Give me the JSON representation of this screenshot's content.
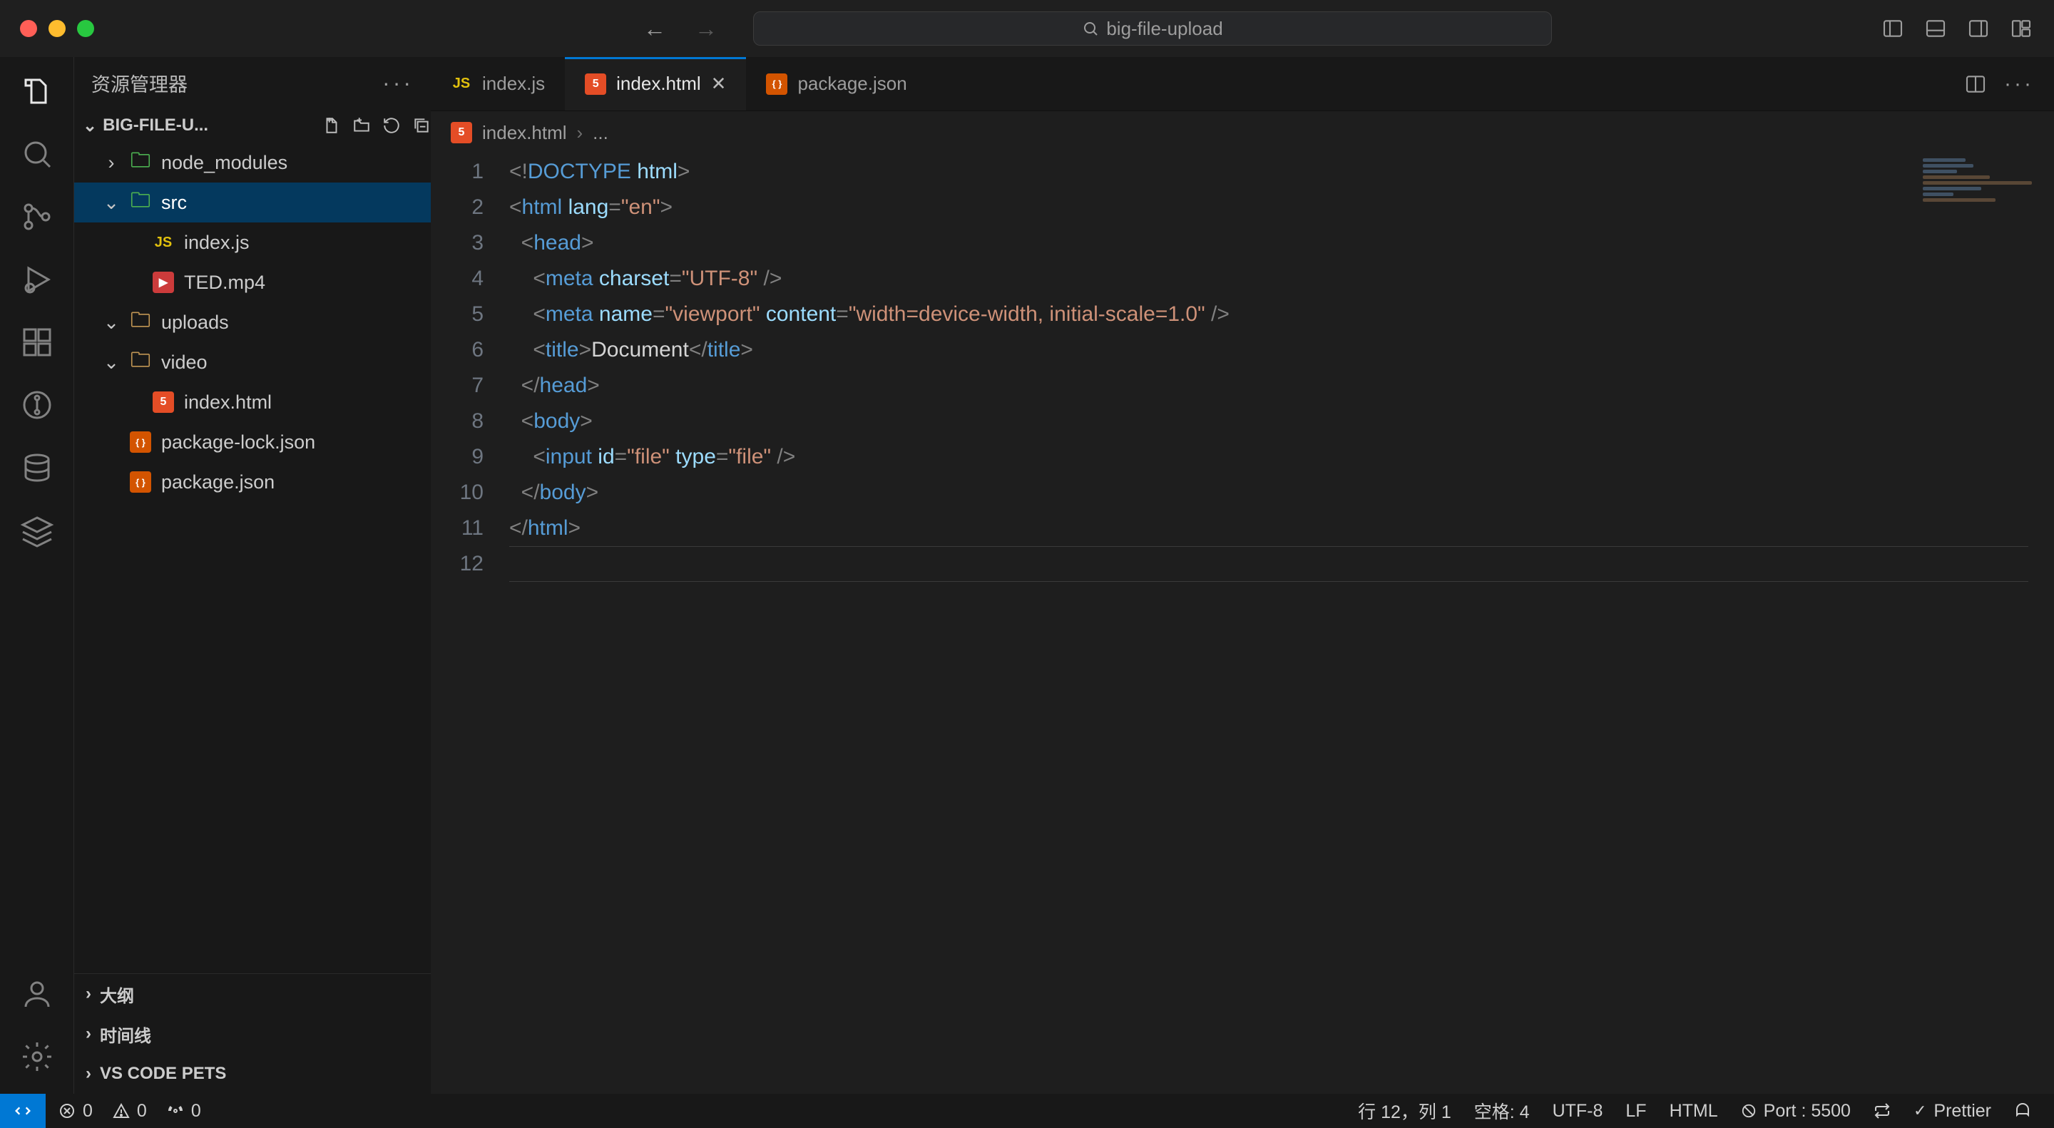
{
  "window": {
    "search_text": "big-file-upload"
  },
  "sidebar": {
    "title": "资源管理器",
    "project": "BIG-FILE-U...",
    "tree": [
      {
        "kind": "folder",
        "label": "node_modules",
        "depth": 1,
        "open": false,
        "chev": "›",
        "icon": "green"
      },
      {
        "kind": "folder",
        "label": "src",
        "depth": 1,
        "open": true,
        "chev": "⌄",
        "icon": "green",
        "selected": true
      },
      {
        "kind": "file",
        "label": "index.js",
        "depth": 2,
        "icon": "js"
      },
      {
        "kind": "file",
        "label": "TED.mp4",
        "depth": 2,
        "icon": "video"
      },
      {
        "kind": "folder",
        "label": "uploads",
        "depth": 1,
        "open": true,
        "chev": "⌄",
        "icon": "folder"
      },
      {
        "kind": "folder",
        "label": "video",
        "depth": 1,
        "open": true,
        "chev": "⌄",
        "icon": "folder"
      },
      {
        "kind": "file",
        "label": "index.html",
        "depth": 2,
        "icon": "html"
      },
      {
        "kind": "file",
        "label": "package-lock.json",
        "depth": 1,
        "icon": "json"
      },
      {
        "kind": "file",
        "label": "package.json",
        "depth": 1,
        "icon": "json"
      }
    ],
    "sections": [
      "大纲",
      "时间线",
      "VS CODE PETS"
    ]
  },
  "tabs": [
    {
      "icon": "js",
      "label": "index.js",
      "active": false
    },
    {
      "icon": "html",
      "label": "index.html",
      "active": true,
      "closable": true
    },
    {
      "icon": "json",
      "label": "package.json",
      "active": false
    }
  ],
  "breadcrumb": {
    "file": "index.html",
    "rest": "..."
  },
  "code_lines": [
    [
      {
        "c": "pun",
        "t": "<!"
      },
      {
        "c": "doctype",
        "t": "DOCTYPE"
      },
      {
        "c": "txt",
        "t": " "
      },
      {
        "c": "attr",
        "t": "html"
      },
      {
        "c": "pun",
        "t": ">"
      }
    ],
    [
      {
        "c": "pun",
        "t": "<"
      },
      {
        "c": "tag",
        "t": "html"
      },
      {
        "c": "txt",
        "t": " "
      },
      {
        "c": "attr",
        "t": "lang"
      },
      {
        "c": "pun",
        "t": "="
      },
      {
        "c": "str",
        "t": "\"en\""
      },
      {
        "c": "pun",
        "t": ">"
      }
    ],
    [
      {
        "c": "txt",
        "t": "  "
      },
      {
        "c": "pun",
        "t": "<"
      },
      {
        "c": "tag",
        "t": "head"
      },
      {
        "c": "pun",
        "t": ">"
      }
    ],
    [
      {
        "c": "txt",
        "t": "    "
      },
      {
        "c": "pun",
        "t": "<"
      },
      {
        "c": "tag",
        "t": "meta"
      },
      {
        "c": "txt",
        "t": " "
      },
      {
        "c": "attr",
        "t": "charset"
      },
      {
        "c": "pun",
        "t": "="
      },
      {
        "c": "str",
        "t": "\"UTF-8\""
      },
      {
        "c": "txt",
        "t": " "
      },
      {
        "c": "pun",
        "t": "/>"
      }
    ],
    [
      {
        "c": "txt",
        "t": "    "
      },
      {
        "c": "pun",
        "t": "<"
      },
      {
        "c": "tag",
        "t": "meta"
      },
      {
        "c": "txt",
        "t": " "
      },
      {
        "c": "attr",
        "t": "name"
      },
      {
        "c": "pun",
        "t": "="
      },
      {
        "c": "str",
        "t": "\"viewport\""
      },
      {
        "c": "txt",
        "t": " "
      },
      {
        "c": "attr",
        "t": "content"
      },
      {
        "c": "pun",
        "t": "="
      },
      {
        "c": "str",
        "t": "\"width=device-width, initial-scale=1.0\""
      },
      {
        "c": "txt",
        "t": " "
      },
      {
        "c": "pun",
        "t": "/>"
      }
    ],
    [
      {
        "c": "txt",
        "t": "    "
      },
      {
        "c": "pun",
        "t": "<"
      },
      {
        "c": "tag",
        "t": "title"
      },
      {
        "c": "pun",
        "t": ">"
      },
      {
        "c": "txt",
        "t": "Document"
      },
      {
        "c": "pun",
        "t": "</"
      },
      {
        "c": "tag",
        "t": "title"
      },
      {
        "c": "pun",
        "t": ">"
      }
    ],
    [
      {
        "c": "txt",
        "t": "  "
      },
      {
        "c": "pun",
        "t": "</"
      },
      {
        "c": "tag",
        "t": "head"
      },
      {
        "c": "pun",
        "t": ">"
      }
    ],
    [
      {
        "c": "txt",
        "t": "  "
      },
      {
        "c": "pun",
        "t": "<"
      },
      {
        "c": "tag",
        "t": "body"
      },
      {
        "c": "pun",
        "t": ">"
      }
    ],
    [
      {
        "c": "txt",
        "t": "    "
      },
      {
        "c": "pun",
        "t": "<"
      },
      {
        "c": "tag",
        "t": "input"
      },
      {
        "c": "txt",
        "t": " "
      },
      {
        "c": "attr",
        "t": "id"
      },
      {
        "c": "pun",
        "t": "="
      },
      {
        "c": "str",
        "t": "\"file\""
      },
      {
        "c": "txt",
        "t": " "
      },
      {
        "c": "attr",
        "t": "type"
      },
      {
        "c": "pun",
        "t": "="
      },
      {
        "c": "str",
        "t": "\"file\""
      },
      {
        "c": "txt",
        "t": " "
      },
      {
        "c": "pun",
        "t": "/>"
      }
    ],
    [
      {
        "c": "txt",
        "t": "  "
      },
      {
        "c": "pun",
        "t": "</"
      },
      {
        "c": "tag",
        "t": "body"
      },
      {
        "c": "pun",
        "t": ">"
      }
    ],
    [
      {
        "c": "pun",
        "t": "</"
      },
      {
        "c": "tag",
        "t": "html"
      },
      {
        "c": "pun",
        "t": ">"
      }
    ],
    []
  ],
  "status": {
    "errors": "0",
    "warnings": "0",
    "ports": "0",
    "cursor": "行 12，列 1",
    "spaces": "空格: 4",
    "encoding": "UTF-8",
    "eol": "LF",
    "lang": "HTML",
    "live": "Port : 5500",
    "prettier": "Prettier"
  }
}
